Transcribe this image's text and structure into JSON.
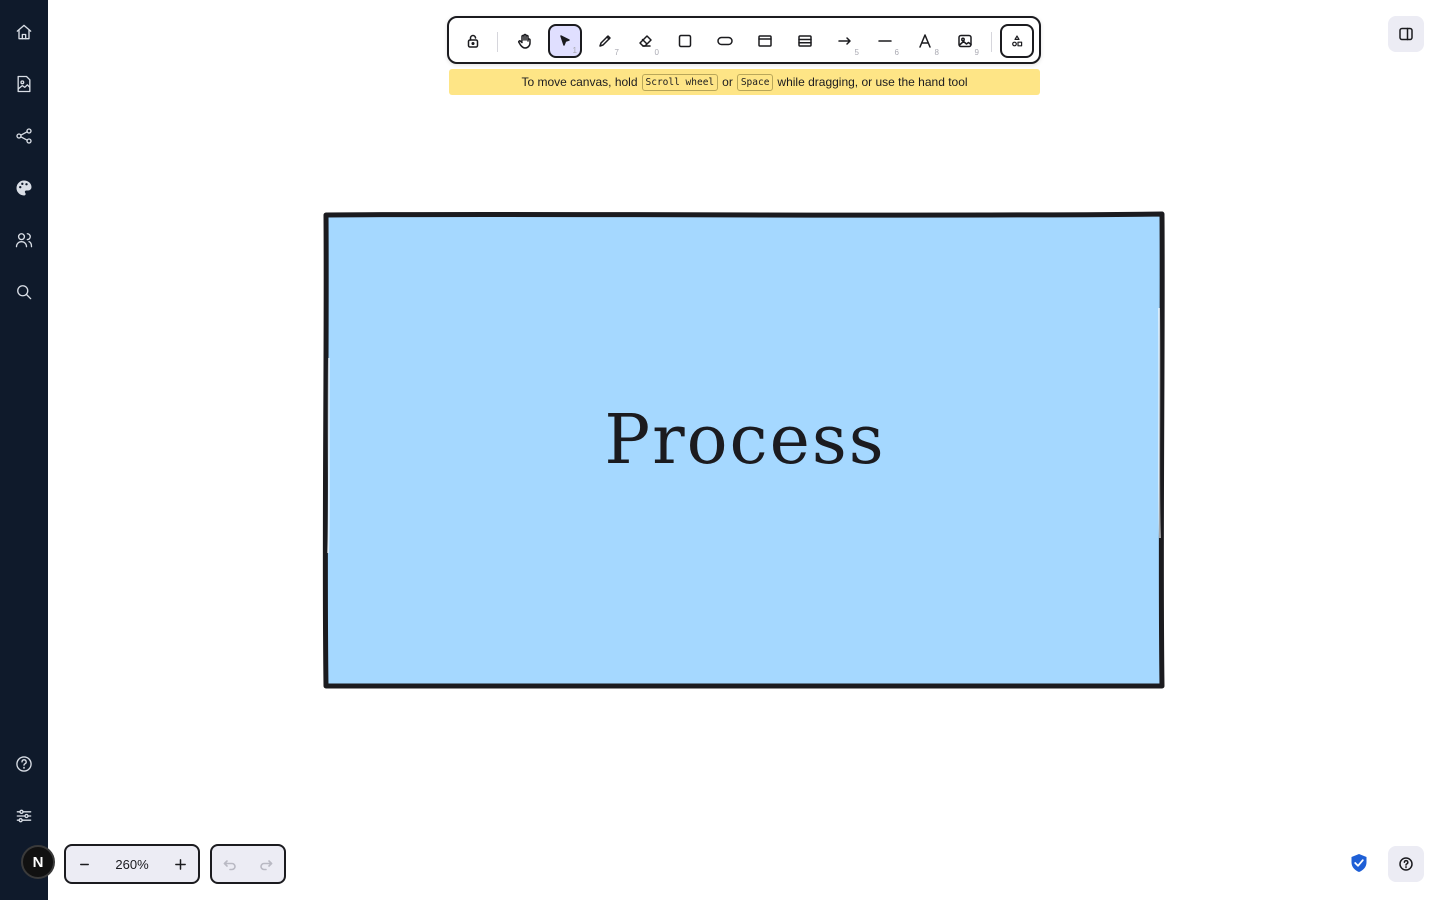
{
  "sidebar": {
    "items": [
      {
        "name": "home",
        "icon": "home-icon"
      },
      {
        "name": "images",
        "icon": "image-document-icon"
      },
      {
        "name": "share",
        "icon": "share-icon"
      },
      {
        "name": "theme",
        "icon": "palette-icon"
      },
      {
        "name": "collaborators",
        "icon": "users-icon"
      },
      {
        "name": "search",
        "icon": "search-icon"
      }
    ],
    "bottom_items": [
      {
        "name": "help",
        "icon": "help-icon"
      },
      {
        "name": "settings",
        "icon": "sliders-icon"
      }
    ],
    "avatar_initial": "N",
    "background": "#0f1a2b"
  },
  "toolbar": {
    "tools": [
      {
        "name": "lock",
        "icon": "lock-icon",
        "key": ""
      },
      {
        "name": "hand",
        "icon": "hand-icon",
        "key": ""
      },
      {
        "name": "selection",
        "icon": "pointer-icon",
        "key": "1",
        "active": true
      },
      {
        "name": "draw",
        "icon": "pencil-icon",
        "key": "7"
      },
      {
        "name": "eraser",
        "icon": "eraser-icon",
        "key": "0"
      },
      {
        "name": "rectangle",
        "icon": "square-icon",
        "key": ""
      },
      {
        "name": "ellipse",
        "icon": "ellipse-icon",
        "key": ""
      },
      {
        "name": "frame",
        "icon": "frame-icon",
        "key": ""
      },
      {
        "name": "table",
        "icon": "table-icon",
        "key": ""
      },
      {
        "name": "arrow",
        "icon": "arrow-icon",
        "key": "5"
      },
      {
        "name": "line",
        "icon": "line-icon",
        "key": "6"
      },
      {
        "name": "text",
        "icon": "text-icon",
        "key": "8"
      },
      {
        "name": "image",
        "icon": "image-icon",
        "key": "9"
      },
      {
        "name": "extra-tools",
        "icon": "shapes-icon",
        "key": ""
      }
    ],
    "active_color": "#e0dfff"
  },
  "hint": {
    "prefix": "To move canvas, hold",
    "key1": "Scroll wheel",
    "middle": "or",
    "key2": "Space",
    "suffix": "while dragging, or use the hand tool",
    "background": "#fee586"
  },
  "canvas": {
    "shape_label": "Process",
    "shape_fill": "#a5d8ff",
    "shape_stroke": "#1b1b1f"
  },
  "zoom": {
    "value": "260%",
    "decrease_icon": "minus-icon",
    "increase_icon": "plus-icon"
  },
  "history": {
    "undo_icon": "undo-icon",
    "redo_icon": "redo-icon"
  },
  "corner": {
    "sidebar_toggle_icon": "sidebar-toggle-icon",
    "help_icon": "help-circle-icon",
    "shield_icon": "shield-check-icon",
    "shield_color": "#1e5fd6"
  }
}
